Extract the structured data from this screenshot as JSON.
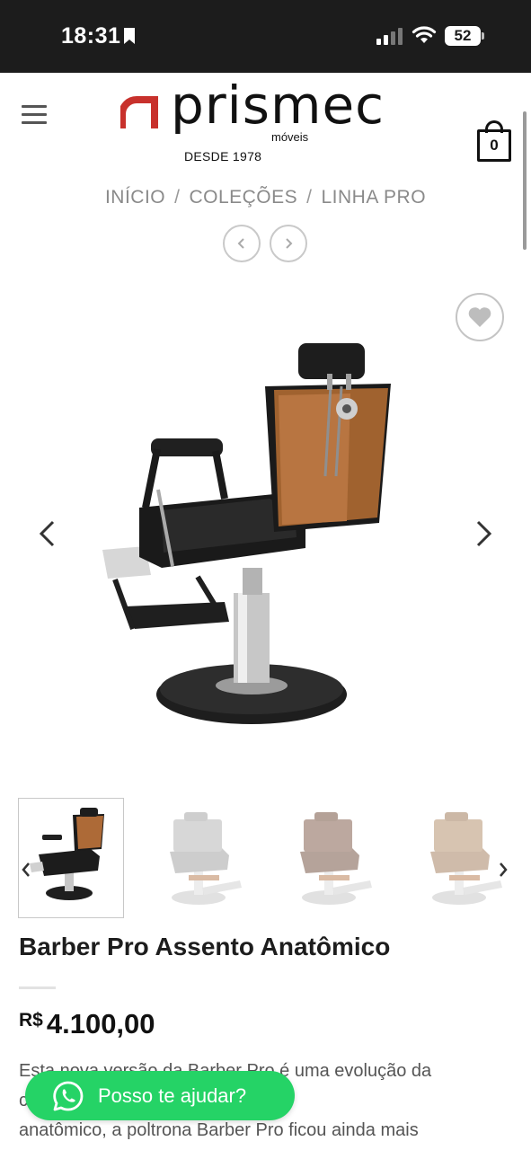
{
  "status_bar": {
    "time": "18:31",
    "battery": "52"
  },
  "header": {
    "logo_name": "prismec",
    "logo_sub": "móveis",
    "logo_since": "DESDE 1978",
    "cart_count": "0"
  },
  "breadcrumb": {
    "items": [
      "INÍCIO",
      "COLEÇÕES",
      "LINHA PRO"
    ],
    "separator": "/"
  },
  "product": {
    "title": "Barber Pro Assento Anatômico",
    "currency": "R$",
    "price": "4.100,00",
    "description_lines": [
      "Esta nova versão da Barber Pro é uma evolução da",
      "c                                              ra com um assento",
      "anatômico, a poltrona Barber Pro ficou ainda mais"
    ],
    "thumbnails": [
      {
        "variant": "black-wood",
        "active": true
      },
      {
        "variant": "gray",
        "active": false
      },
      {
        "variant": "brown",
        "active": false
      },
      {
        "variant": "tan",
        "active": false
      }
    ]
  },
  "whatsapp": {
    "label": "Posso te ajudar?"
  },
  "colors": {
    "status_bar_bg": "#1c1c1c",
    "logo_accent": "#c8312c",
    "whatsapp_green": "#25d366",
    "breadcrumb_text": "#8a8a8a"
  },
  "icons": [
    "menu-icon",
    "cart-icon",
    "heart-icon",
    "chevron-left-icon",
    "chevron-right-icon",
    "whatsapp-icon",
    "bookmark-icon",
    "signal-icon",
    "wifi-icon",
    "battery-icon"
  ]
}
